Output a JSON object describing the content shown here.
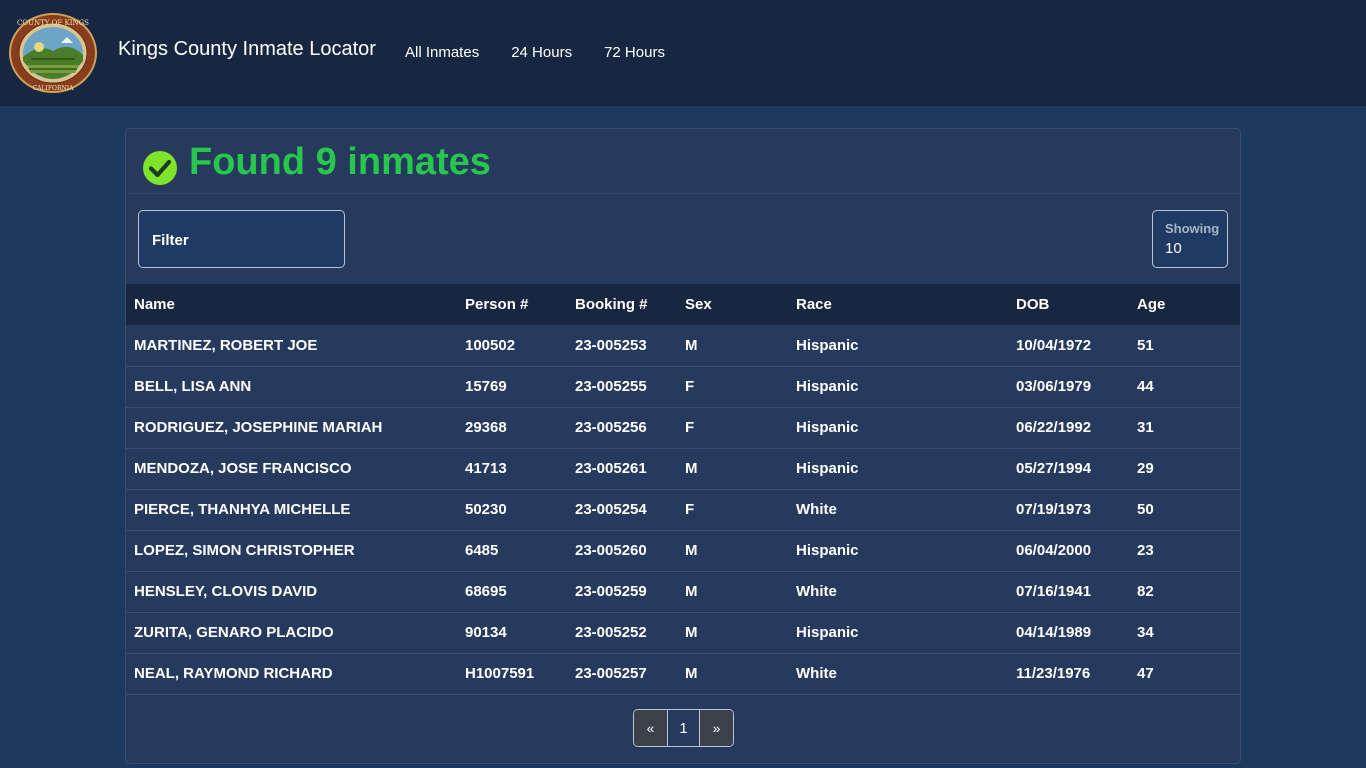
{
  "navbar": {
    "brand": "Kings County Inmate Locator",
    "links": [
      "All Inmates",
      "24 Hours",
      "72 Hours"
    ],
    "seal_text_top": "COUNTY OF KINGS",
    "seal_text_bottom": "CALIFORNIA"
  },
  "header": {
    "title": "Found 9 inmates",
    "icon": "check-circle-icon"
  },
  "filter": {
    "label": "Filter",
    "value": ""
  },
  "showing": {
    "label": "Showing",
    "value": "10"
  },
  "table": {
    "columns": [
      "Name",
      "Person #",
      "Booking #",
      "Sex",
      "Race",
      "DOB",
      "Age"
    ],
    "rows": [
      [
        "MARTINEZ, ROBERT JOE",
        "100502",
        "23-005253",
        "M",
        "Hispanic",
        "10/04/1972",
        "51"
      ],
      [
        "BELL, LISA ANN",
        "15769",
        "23-005255",
        "F",
        "Hispanic",
        "03/06/1979",
        "44"
      ],
      [
        "RODRIGUEZ, JOSEPHINE MARIAH",
        "29368",
        "23-005256",
        "F",
        "Hispanic",
        "06/22/1992",
        "31"
      ],
      [
        "MENDOZA, JOSE FRANCISCO",
        "41713",
        "23-005261",
        "M",
        "Hispanic",
        "05/27/1994",
        "29"
      ],
      [
        "PIERCE, THANHYA MICHELLE",
        "50230",
        "23-005254",
        "F",
        "White",
        "07/19/1973",
        "50"
      ],
      [
        "LOPEZ, SIMON CHRISTOPHER",
        "6485",
        "23-005260",
        "M",
        "Hispanic",
        "06/04/2000",
        "23"
      ],
      [
        "HENSLEY, CLOVIS DAVID",
        "68695",
        "23-005259",
        "M",
        "White",
        "07/16/1941",
        "82"
      ],
      [
        "ZURITA, GENARO PLACIDO",
        "90134",
        "23-005252",
        "M",
        "Hispanic",
        "04/14/1989",
        "34"
      ],
      [
        "NEAL, RAYMOND RICHARD",
        "H1007591",
        "23-005257",
        "M",
        "White",
        "11/23/1976",
        "47"
      ]
    ]
  },
  "pagination": {
    "prev": "«",
    "current": "1",
    "next": "»"
  },
  "colors": {
    "page_bg": "#1b3a5e",
    "navbar_bg": "#172741",
    "card_bg": "#263a5e",
    "success_green": "#27c74e",
    "check_green": "#7ee32b"
  }
}
